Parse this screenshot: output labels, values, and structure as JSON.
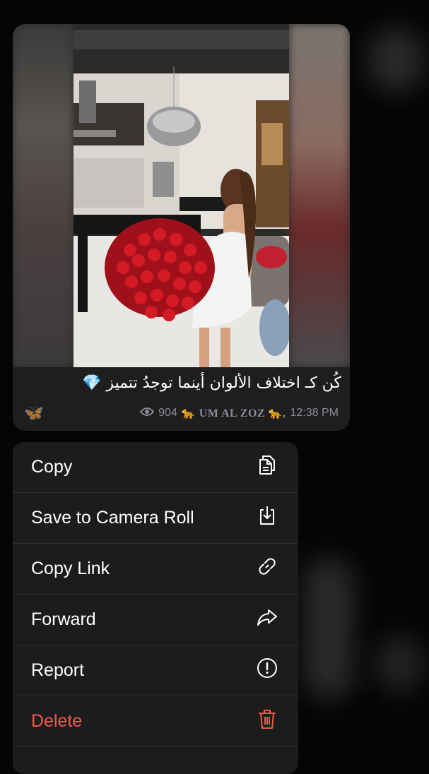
{
  "message": {
    "caption": "كُن كـ اختلاف الألوان أينما توجدُ تتميز 💎",
    "emoji_line": "🦋",
    "views": "904",
    "channel": "🐆 UM AL ZOZ 🐆,",
    "time": "12:38 PM"
  },
  "context_menu": {
    "items": [
      {
        "label": "Copy",
        "icon": "copy-icon"
      },
      {
        "label": "Save to Camera Roll",
        "icon": "save-download-icon"
      },
      {
        "label": "Copy Link",
        "icon": "link-icon"
      },
      {
        "label": "Forward",
        "icon": "forward-arrow-icon"
      },
      {
        "label": "Report",
        "icon": "exclamation-circle-icon"
      },
      {
        "label": "Delete",
        "icon": "trash-icon"
      }
    ]
  },
  "colors": {
    "menu_background": "#1c1c1e",
    "danger": "#ec5b4b",
    "meta_text": "#8d8d93"
  }
}
